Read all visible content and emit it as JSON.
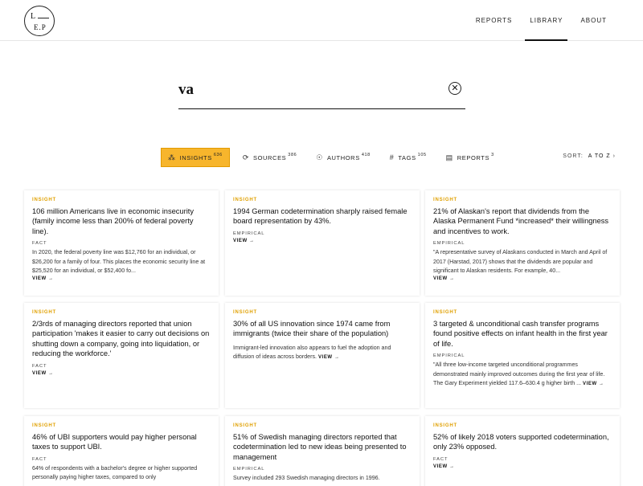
{
  "logo": {
    "line1": "L",
    "line2": "E.P"
  },
  "nav": {
    "items": [
      "REPORTS",
      "LIBRARY",
      "ABOUT"
    ],
    "active": "LIBRARY"
  },
  "search": {
    "value": "va",
    "clear_icon": "close-icon"
  },
  "filters": [
    {
      "label": "INSIGHTS",
      "count": "636",
      "icon": "insights-icon",
      "active": true
    },
    {
      "label": "SOURCES",
      "count": "386",
      "icon": "sources-icon",
      "active": false
    },
    {
      "label": "AUTHORS",
      "count": "418",
      "icon": "authors-icon",
      "active": false
    },
    {
      "label": "TAGS",
      "count": "105",
      "icon": "tags-icon",
      "active": false
    },
    {
      "label": "REPORTS",
      "count": "3",
      "icon": "reports-icon",
      "active": false
    }
  ],
  "sort": {
    "label": "SORT:",
    "value": "A TO Z"
  },
  "colors": {
    "accent": "#f7b52c",
    "badge": "#e0a000"
  },
  "cards": [
    {
      "badge": "INSIGHT",
      "title": "106 million Americans live in economic insecurity (family income less than 200% of federal poverty line).",
      "kind": "FACT",
      "body": "In 2020, the federal poverty line was $12,760 for an individual, or $26,200 for a family of four. This places the economic security line at $25,520 for an individual, or $52,400 fo...",
      "view": "VIEW →"
    },
    {
      "badge": "INSIGHT",
      "title": "1994 German codetermination sharply raised female board representation by 43%.",
      "kind": "EMPIRICAL",
      "body": "",
      "view": "VIEW →"
    },
    {
      "badge": "INSIGHT",
      "title": "21% of Alaskan's report that dividends from the Alaska Permanent Fund *increased* their willingness and incentives to work.",
      "kind": "EMPIRICAL",
      "body": "\"A representative survey of Alaskans conducted in March and April of 2017 (Harstad, 2017) shows that the dividends are popular and significant to Alaskan residents. For example, 40...",
      "view": "VIEW →"
    },
    {
      "badge": "INSIGHT",
      "title": "2/3rds of managing directors reported that union participation 'makes it easier to carry out decisions on shutting down a company, going into liquidation, or reducing the workforce.'",
      "kind": "FACT",
      "body": "",
      "view": "VIEW →"
    },
    {
      "badge": "INSIGHT",
      "title": "30% of all US innovation since 1974 came from immigrants (twice their share of the population)",
      "kind": "",
      "body": "Immigrant-led innovation also appears to fuel the adoption and diffusion of ideas across borders.",
      "view": "VIEW →"
    },
    {
      "badge": "INSIGHT",
      "title": "3 targeted & unconditional cash transfer programs found positive effects on infant health in the first year of life.",
      "kind": "EMPIRICAL",
      "body": "\"All three low-income targeted unconditional programmes demonstrated mainly improved outcomes during the first year of life. The Gary Experiment yielded 117.6–630.4 g higher birth ...",
      "view": "VIEW →"
    },
    {
      "badge": "INSIGHT",
      "title": "46% of UBI supporters would pay higher personal taxes to support UBI.",
      "kind": "FACT",
      "body": "64% of respondents with a bachelor's degree or higher supported personally paying higher taxes, compared to only",
      "view": ""
    },
    {
      "badge": "INSIGHT",
      "title": "51% of Swedish managing directors reported that codetermination led to new ideas being presented to management",
      "kind": "EMPIRICAL",
      "body": "Survey included 293 Swedish managing directors in 1996.",
      "view": ""
    },
    {
      "badge": "INSIGHT",
      "title": "52% of likely 2018 voters supported codetermination, only 23% opposed.",
      "kind": "FACT",
      "body": "",
      "view": "VIEW →"
    }
  ]
}
